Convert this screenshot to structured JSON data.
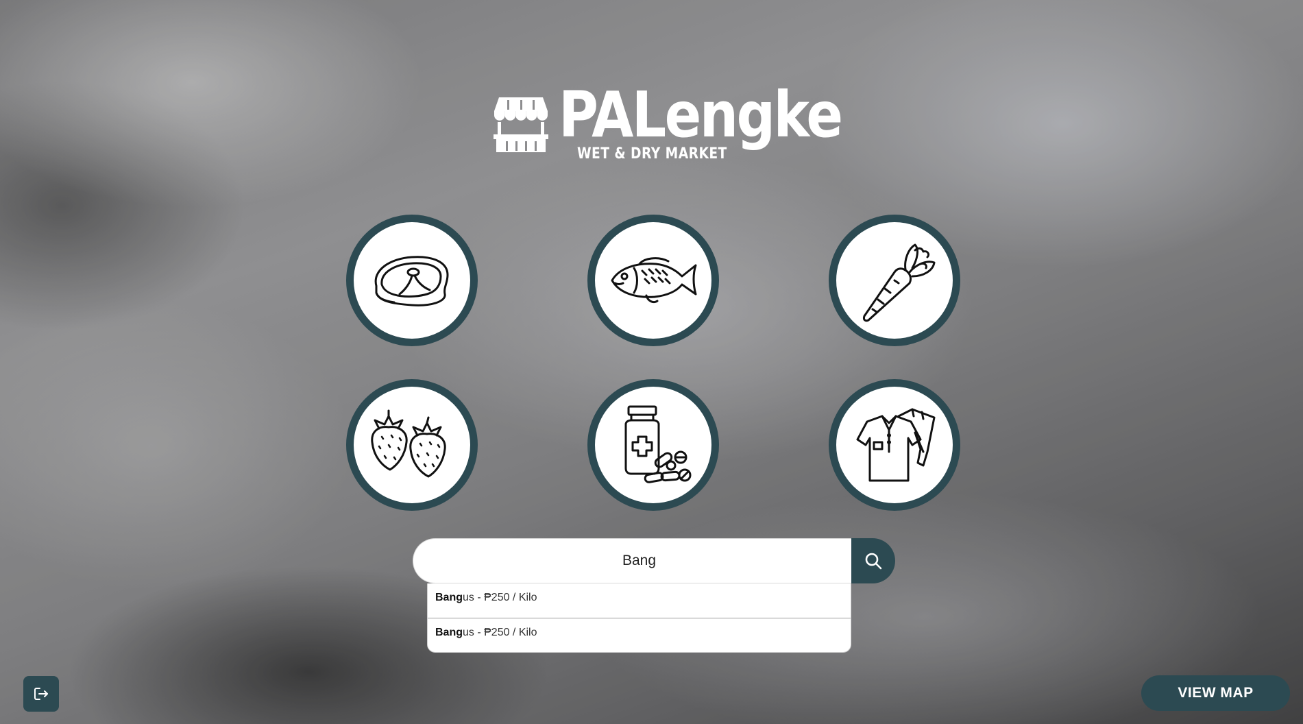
{
  "brand": {
    "name": "PALengke",
    "tagline": "WET & DRY MARKET",
    "logo_icon": "market-stall-icon"
  },
  "categories": [
    {
      "icon": "meat-steak-icon"
    },
    {
      "icon": "fish-icon"
    },
    {
      "icon": "carrot-vegetable-icon"
    },
    {
      "icon": "strawberry-fruit-icon"
    },
    {
      "icon": "medicine-pills-icon"
    },
    {
      "icon": "clothing-shirt-pants-icon"
    }
  ],
  "search": {
    "value": "Bang",
    "icon": "search-icon",
    "suggestions": [
      {
        "match": "Bang",
        "rest": "us - ₱250 / Kilo"
      },
      {
        "match": "Bang",
        "rest": "us - ₱250 / Kilo"
      }
    ]
  },
  "footer": {
    "logout_icon": "logout-icon",
    "view_map_label": "VIEW MAP"
  },
  "colors": {
    "accent": "#2c4a52",
    "text_light": "#ffffff"
  }
}
